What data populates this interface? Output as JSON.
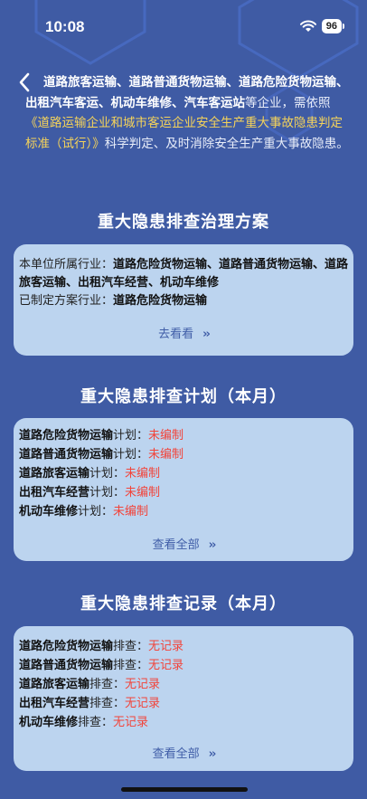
{
  "status": {
    "time": "10:08",
    "battery": "96"
  },
  "intro": {
    "part1": "道路旅客运输、道路普通货物运输、道路危险货物运输、出租汽车客运、机动车维修、汽车客运站",
    "part2": "等企业，需依照",
    "link": "《道路运输企业和城市客运企业安全生产重大事故隐患判定标准（试行）》",
    "part3": "科学判定、及时消除安全生产重大事故隐患。"
  },
  "plan_section": {
    "title": "重大隐患排查治理方案",
    "industry_label": "本单位所属行业：",
    "industry_value": "道路危险货物运输、道路普通货物运输、道路旅客运输、出租汽车经营、机动车维修",
    "made_label": "已制定方案行业：",
    "made_value": "道路危险货物运输",
    "more": "去看看"
  },
  "schedule_section": {
    "title": "重大隐患排查计划（本月）",
    "suffix": "计划：",
    "items": [
      {
        "name": "道路危险货物运输",
        "status": "未编制"
      },
      {
        "name": "道路普通货物运输",
        "status": "未编制"
      },
      {
        "name": "道路旅客运输",
        "status": "未编制"
      },
      {
        "name": "出租汽车经营",
        "status": "未编制"
      },
      {
        "name": "机动车维修",
        "status": "未编制"
      }
    ],
    "more": "查看全部"
  },
  "record_section": {
    "title": "重大隐患排查记录（本月）",
    "suffix": "排查：",
    "items": [
      {
        "name": "道路危险货物运输",
        "status": "无记录"
      },
      {
        "name": "道路普通货物运输",
        "status": "无记录"
      },
      {
        "name": "道路旅客运输",
        "status": "无记录"
      },
      {
        "name": "出租汽车经营",
        "status": "无记录"
      },
      {
        "name": "机动车维修",
        "status": "无记录"
      }
    ],
    "more": "查看全部"
  },
  "icons": {
    "back": "chevron-left-icon",
    "wifi": "wifi-icon",
    "battery": "battery-icon",
    "more": "double-chevron-right-icon"
  },
  "colors": {
    "background": "#3f5ba4",
    "card": "#bcd4ef",
    "link": "#f5d35a",
    "status_red": "#f2443a",
    "more_text": "#3f5da7"
  }
}
